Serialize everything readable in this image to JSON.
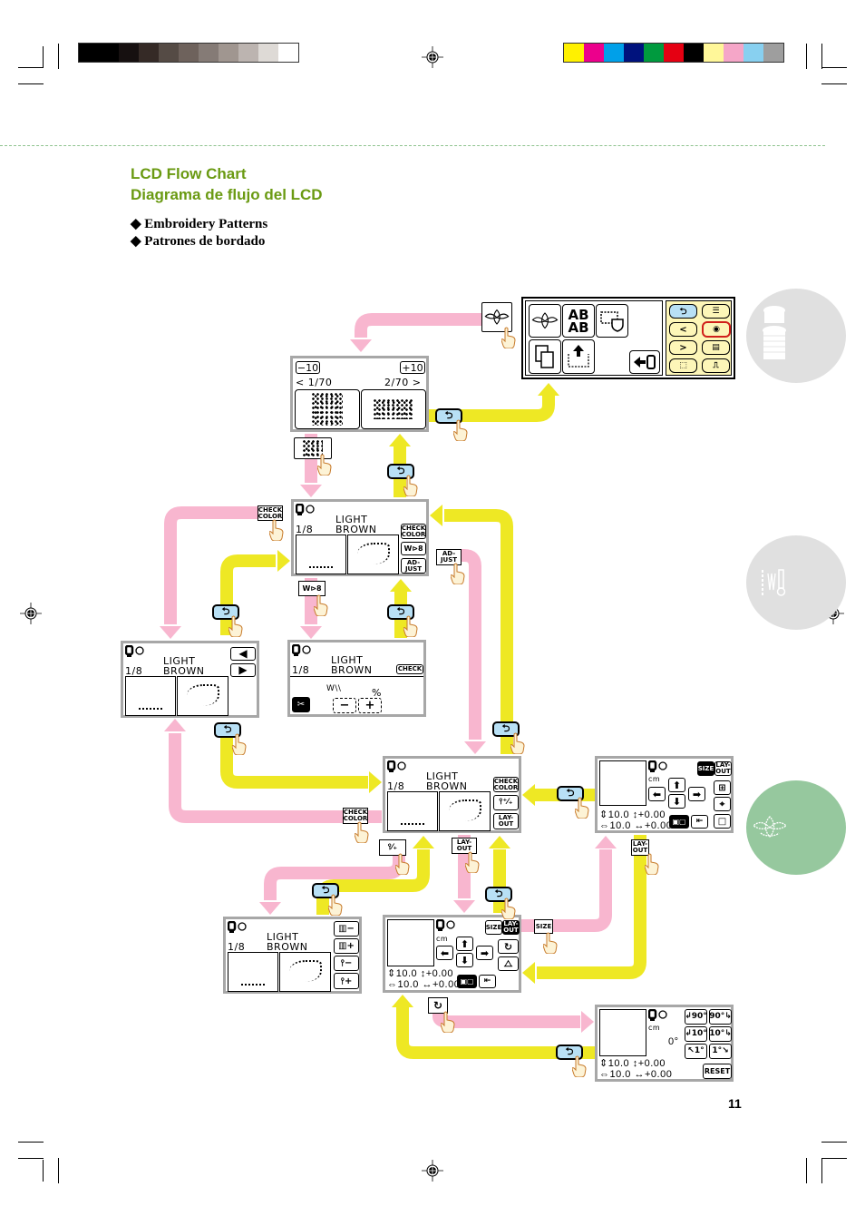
{
  "header": {
    "title_en": "LCD Flow Chart",
    "title_es": "Diagrama de flujo del LCD",
    "bullet_en": "◆ Embroidery Patterns",
    "bullet_es": "◆ Patrones de bordado"
  },
  "color_bars": {
    "grays": [
      "#000000",
      "#000000",
      "#161010",
      "#352a26",
      "#554b45",
      "#6e625c",
      "#857b76",
      "#a09690",
      "#bcb4b0",
      "#dedad6",
      "#ffffff"
    ],
    "process": [
      "#fff100",
      "#ec008c",
      "#00a0e9",
      "#00127d",
      "#009a3e",
      "#e50012",
      "#000000",
      "#fff799",
      "#f5a6c8",
      "#88d0f0",
      "#9e9e9e"
    ]
  },
  "colors": {
    "pink_arrow": "#f8b6cf",
    "yellow_arrow": "#eee824",
    "title_green": "#6a9a12",
    "tab_active": "#96c89e",
    "tab_inactive": "#e0e0e0",
    "back_key": "#b8e0f5",
    "home_panel": "#fdf6b8"
  },
  "home_screen": {
    "left_buttons": [
      "embroidery-pattern",
      "AB AB",
      "frame-pattern",
      "copy",
      "pocket-upload",
      "exit"
    ],
    "ab_label": "AB\nAB",
    "right_buttons": [
      "⮌",
      "☰",
      "<",
      "◉",
      ">",
      "▤",
      "⬚",
      "⎍"
    ]
  },
  "pattern_select": {
    "minus10": "−10",
    "plus10": "+10",
    "page_left": "< 1/70",
    "page_right": "2/70 >"
  },
  "color_screen": {
    "fraction": "1/8",
    "color_line1": "LIGHT",
    "color_line2": "BROWN",
    "check_color": "CHECK\nCOLOR",
    "adjust": "AD-\nJUST",
    "layout": "LAY-\nOUT",
    "thread_cut": "W\\\\⊳8"
  },
  "tension_screen": {
    "check": "CHECK",
    "percent": "%",
    "minus": "−",
    "plus": "+",
    "stitch_label": "W\\\\"
  },
  "check_screen": {
    "prev": "◀",
    "next": "▶"
  },
  "layout_screen": {
    "unit": "cm",
    "height_val": "10.0",
    "width_val": "10.0",
    "v_offset": "+0.00",
    "h_offset": "+0.00",
    "size_label": "SIZE",
    "layout_label": "LAY-\nOUT"
  },
  "rotate_screen": {
    "angle": "0°",
    "rot_left_90": "↲90°",
    "rot_right_90": "90°↳",
    "rot_left_10": "↲10°",
    "rot_right_10": "10°↳",
    "rot_left_1": "↖1°",
    "rot_right_1": "1°↘",
    "reset": "RESET"
  },
  "flow_keys": {
    "back": "⮌",
    "check_color": "CHECK\nCOLOR",
    "adjust": "AD-\nJUST",
    "layout": "LAY-\nOUT",
    "size": "SIZE",
    "rotate": "↻"
  },
  "page_number": "11"
}
